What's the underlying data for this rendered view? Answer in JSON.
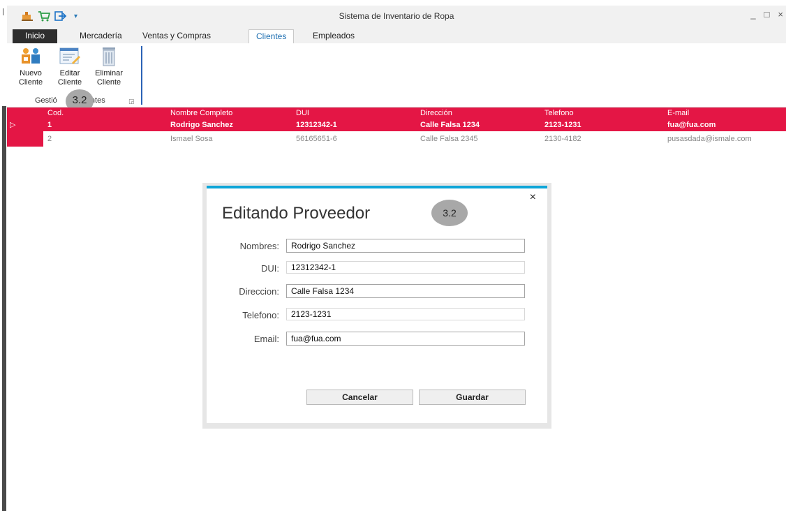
{
  "window": {
    "title": "Sistema de Inventario de Ropa",
    "minimize": "_",
    "maximize": "□",
    "close": "×",
    "qat_dropdown": "▾"
  },
  "tabs": [
    {
      "label": "Inicio"
    },
    {
      "label": "Mercadería"
    },
    {
      "label": "Ventas y Compras"
    },
    {
      "label": "Clientes"
    },
    {
      "label": "Empleados"
    }
  ],
  "ribbon": {
    "buttons": [
      {
        "line1": "Nuevo",
        "line2": "Cliente",
        "icon": "new-client-icon"
      },
      {
        "line1": "Editar",
        "line2": "Cliente",
        "icon": "edit-client-icon"
      },
      {
        "line1": "Eliminar",
        "line2": "Cliente",
        "icon": "delete-client-icon"
      }
    ],
    "group_label_left": "Gestió",
    "group_label_right": "entes",
    "launcher": "◲"
  },
  "badges": {
    "ribbon": "3.2",
    "dialog": "3.2"
  },
  "grid": {
    "columns": [
      "Cod.",
      "Nombre Completo",
      "DUI",
      "Dirección",
      "Telefono",
      "E-mail"
    ],
    "rows": [
      {
        "cod": "1",
        "nombre": "Rodrigo Sanchez",
        "dui": "12312342-1",
        "direccion": "Calle Falsa 1234",
        "telefono": "2123-1231",
        "email": "fua@fua.com"
      },
      {
        "cod": "2",
        "nombre": "Ismael Sosa",
        "dui": "56165651-6",
        "direccion": "Calle Falsa 2345",
        "telefono": "2130-4182",
        "email": "pusasdada@ismale.com"
      }
    ],
    "row_pointer": "▷"
  },
  "dialog": {
    "title": "Editando Proveedor",
    "close": "×",
    "fields": [
      {
        "label": "Nombres:",
        "value": "Rodrigo Sanchez"
      },
      {
        "label": "DUI:",
        "value": "12312342-1"
      },
      {
        "label": "Direccion:",
        "value": "Calle Falsa 1234"
      },
      {
        "label": "Telefono:",
        "value": "2123-1231"
      },
      {
        "label": "Email:",
        "value": "fua@fua.com"
      }
    ],
    "cancel": "Cancelar",
    "save": "Guardar"
  },
  "colors": {
    "accent_red": "#e41645",
    "dialog_accent": "#0ea5d8",
    "ribbon_separator": "#2b63b6"
  }
}
